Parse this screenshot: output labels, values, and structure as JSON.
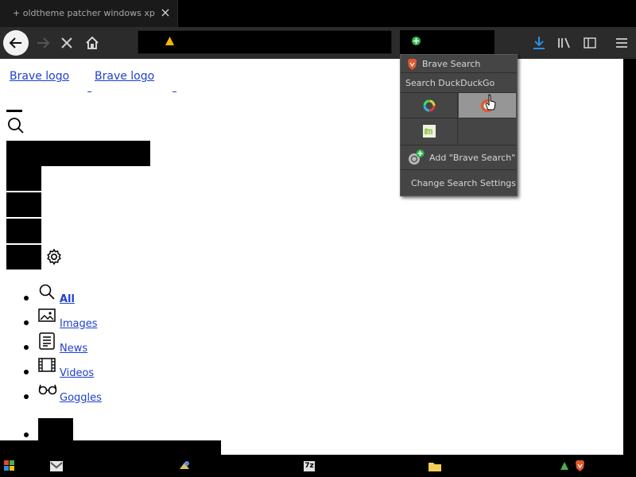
{
  "browser": {
    "tab_title": "+ oldtheme patcher windows xp - B",
    "tab_close": "×",
    "url_text": "",
    "search_text": ""
  },
  "page": {
    "logo_alt_1": "Brave logo",
    "logo_alt_2": "Brave logo",
    "nav": [
      {
        "label": "All",
        "icon": "search-icon"
      },
      {
        "label": "Images",
        "icon": "image-icon"
      },
      {
        "label": "News",
        "icon": "news-icon"
      },
      {
        "label": "Videos",
        "icon": "film-icon"
      },
      {
        "label": "Goggles",
        "icon": "glasses-icon"
      }
    ]
  },
  "search_popup": {
    "current_engine": "Brave Search",
    "search_with_label": "Search DuckDuckGo",
    "engines": [
      "rainbow-ring-icon",
      "duckduckgo-icon",
      "mojeek-icon",
      ""
    ],
    "add_engine_label": "Add \"Brave Search\"",
    "settings_label": "Change Search Settings"
  },
  "taskbar": {
    "items": [
      "start-icon",
      "gmail-icon",
      "app-icon",
      "7zip-icon",
      "folder-icon",
      "tray-icon",
      "brave-tray-icon"
    ],
    "seven_zip_label": "7z"
  },
  "colors": {
    "link": "#1f3fd1",
    "toolbar": "#2b2b2b",
    "popup": "#454545",
    "popup_hover": "#969696",
    "download_accent": "#2a8fe6",
    "warning": "#f5b800"
  }
}
